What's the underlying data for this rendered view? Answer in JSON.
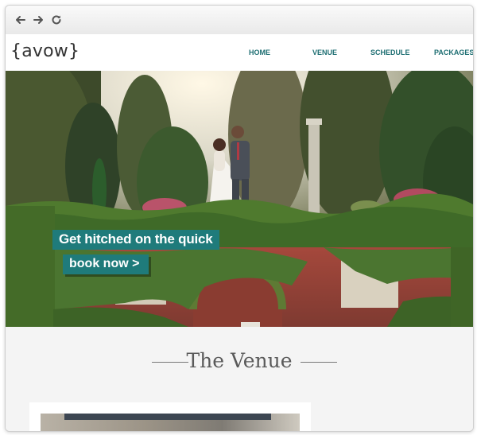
{
  "browser": {
    "back_icon": "arrow-left-icon",
    "forward_icon": "arrow-right-icon",
    "reload_icon": "reload-icon"
  },
  "site": {
    "logo": "{avow}",
    "nav": [
      {
        "label": "HOME"
      },
      {
        "label": "VENUE"
      },
      {
        "label": "SCHEDULE"
      },
      {
        "label": "PACKAGES"
      }
    ],
    "accent_color": "#1f7b7b"
  },
  "hero": {
    "headline": "Get hitched on the quick",
    "cta": "book now >"
  },
  "venue": {
    "title": "The Venue"
  }
}
